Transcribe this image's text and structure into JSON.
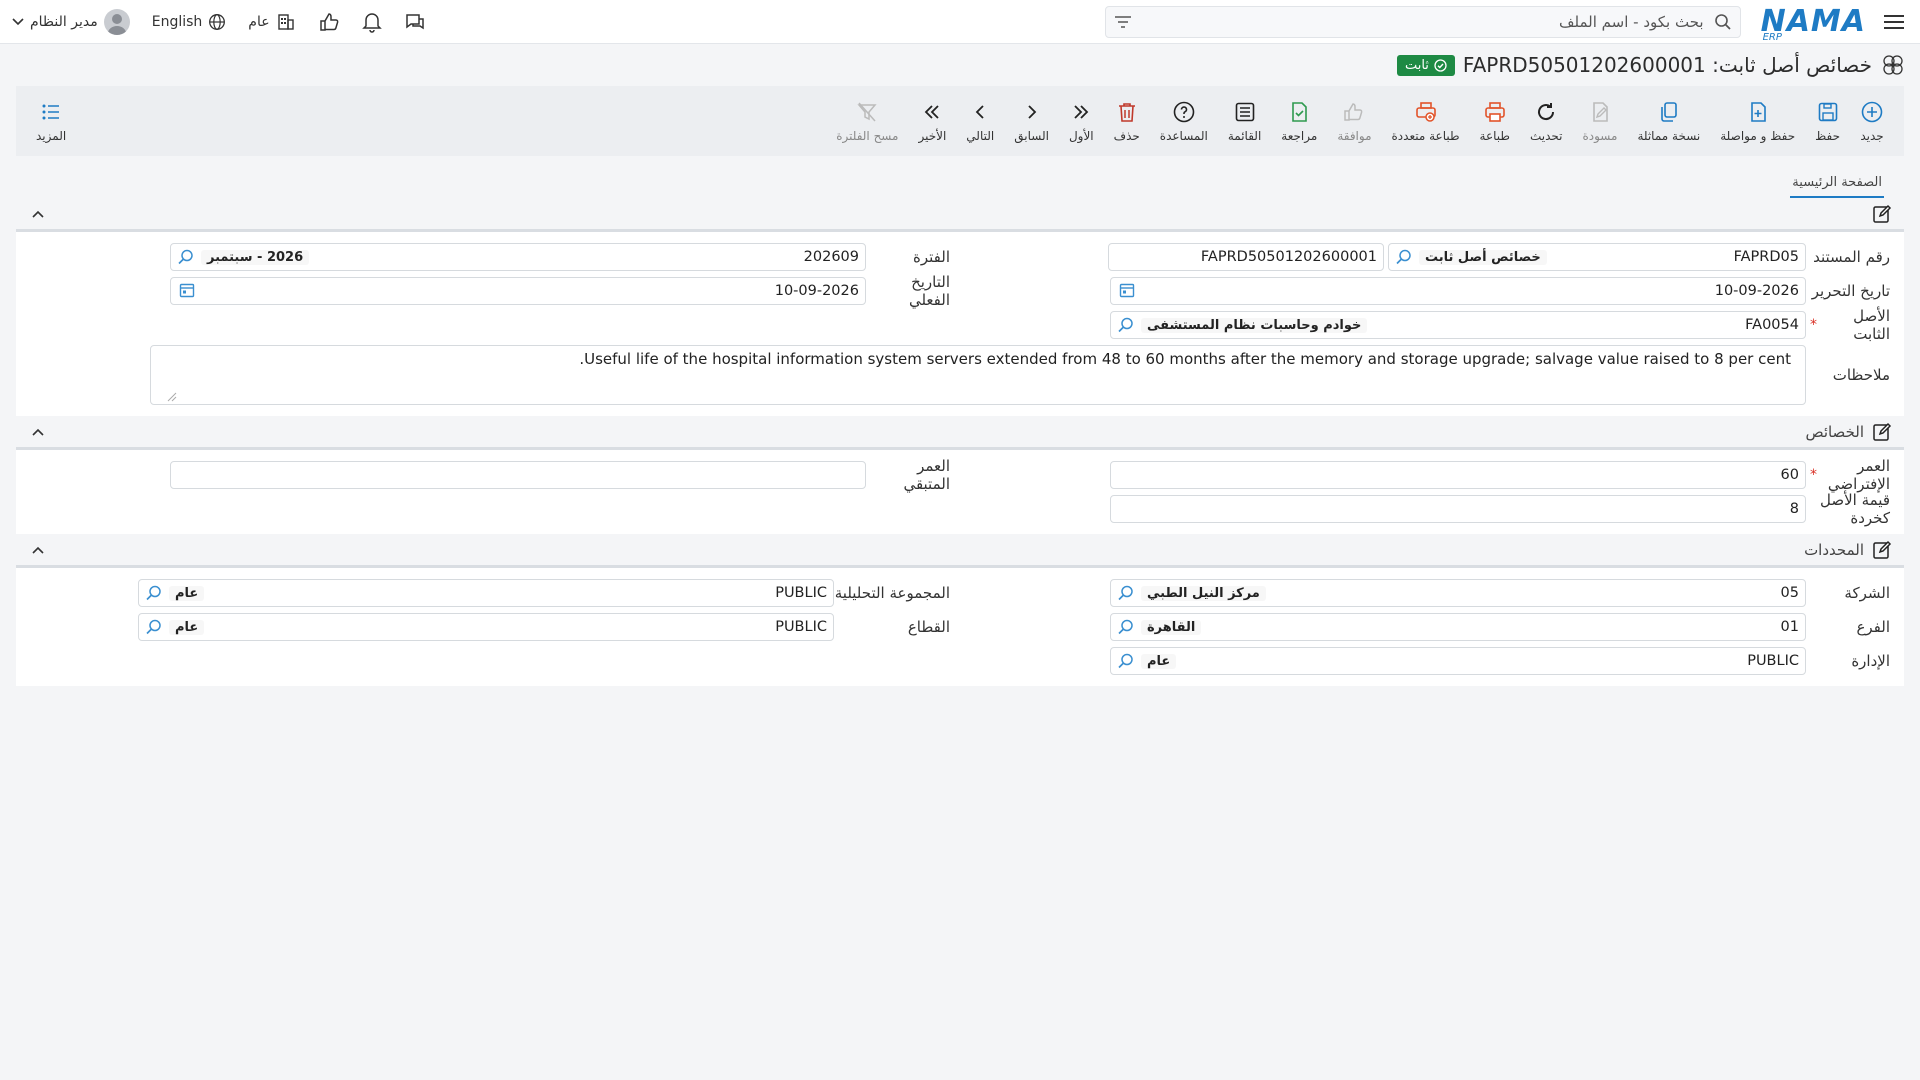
{
  "topbar": {
    "logo_text": "NAMA",
    "logo_sub": "ERP",
    "search_placeholder": "بحث بكود - اسم الملف",
    "user_name": "مدير النظام",
    "language": "English",
    "scope": "عام"
  },
  "title": {
    "text": "خصائص أصل ثابت: FAPRD50501202600001",
    "status": "ثابت"
  },
  "toolbar": {
    "new": "جديد",
    "save": "حفظ",
    "save_continue": "حفظ و مواصلة",
    "copy": "نسخة مماثلة",
    "draft": "مسودة",
    "refresh": "تحديث",
    "print": "طباعة",
    "multi_print": "طباعة متعددة",
    "approve": "موافقة",
    "review": "مراجعة",
    "list": "القائمة",
    "help": "المساعدة",
    "delete": "حذف",
    "first": "الأول",
    "prev": "السابق",
    "next": "التالي",
    "last": "الأخير",
    "clear_filter": "مسح الفلترة",
    "more": "المزيد"
  },
  "tabs": {
    "main": "الصفحة الرئيسية"
  },
  "header_section": {
    "doc_no_label": "رقم المستند",
    "doc_code": "FAPRD05",
    "doc_code_name": "خصائص أصل ثابت",
    "doc_full_no": "FAPRD50501202600001",
    "period_label": "الفترة",
    "period_value": "202609",
    "period_name": "2026 - سبتمبر",
    "edit_date_label": "تاريخ التحرير",
    "edit_date": "10-09-2026",
    "actual_date_label": "التاريخ الفعلي",
    "actual_date": "10-09-2026",
    "asset_label": "الأصل الثابت",
    "asset_code": "FA0054",
    "asset_name": "خوادم وحاسبات نظام المستشفى",
    "notes_label": "ملاحظات",
    "notes": "Useful life of the hospital information system servers extended from 48 to 60 months after the memory and storage upgrade; salvage value raised to 8 per cent."
  },
  "properties_section": {
    "title": "الخصائص",
    "default_life_label": "العمر الإفتراضي",
    "default_life": "60",
    "remaining_life_label": "العمر المتبقي",
    "remaining_life": "",
    "scrap_value_label": "قيمة الأصل كخردة",
    "scrap_value": "8"
  },
  "dimensions_section": {
    "title": "المحددات",
    "company_label": "الشركة",
    "company_code": "05",
    "company_name": "مركز النيل الطبي",
    "analytic_label": "المجموعة التحليلية",
    "analytic_code": "PUBLIC",
    "analytic_name": "عام",
    "branch_label": "الفرع",
    "branch_code": "01",
    "branch_name": "القاهرة",
    "sector_label": "القطاع",
    "sector_code": "PUBLIC",
    "sector_name": "عام",
    "dept_label": "الإدارة",
    "dept_code": "PUBLIC",
    "dept_name": "عام"
  },
  "colors": {
    "brand": "#1e7bc4",
    "status_green": "#1e8a44",
    "print_orange": "#e2542a",
    "delete_red": "#c0392b",
    "review_green": "#2e9a4f"
  }
}
